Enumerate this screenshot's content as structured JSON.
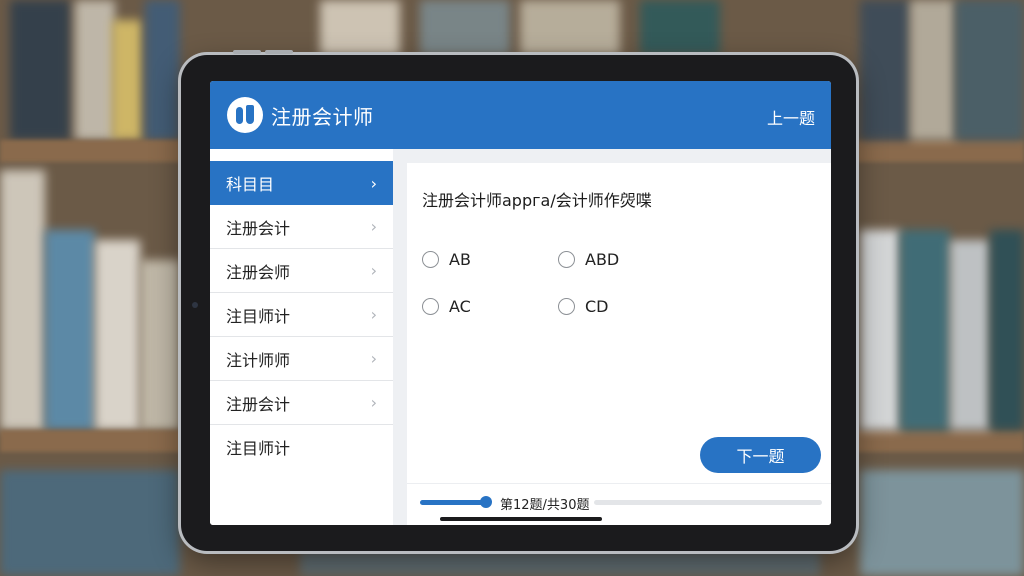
{
  "app": {
    "title": "注册会计师",
    "prev_label": "上一题",
    "next_label": "下一题"
  },
  "sidebar": {
    "items": [
      {
        "label": "科目目",
        "active": true
      },
      {
        "label": "注册会计"
      },
      {
        "label": "注册会师"
      },
      {
        "label": "注目师计"
      },
      {
        "label": "注计师师"
      },
      {
        "label": "注册会计"
      },
      {
        "label": "注目师计"
      }
    ]
  },
  "question": {
    "text": "注册会计师appга/会计师作焈喋",
    "options": [
      "AB",
      "ABD",
      "AC",
      "CD"
    ]
  },
  "progress": {
    "text": "第12题/共30题",
    "current": 12,
    "total": 30
  },
  "colors": {
    "accent": "#2873c4"
  },
  "icons": {
    "chevron": "chevron-right-icon",
    "logo": "app-logo-icon"
  }
}
